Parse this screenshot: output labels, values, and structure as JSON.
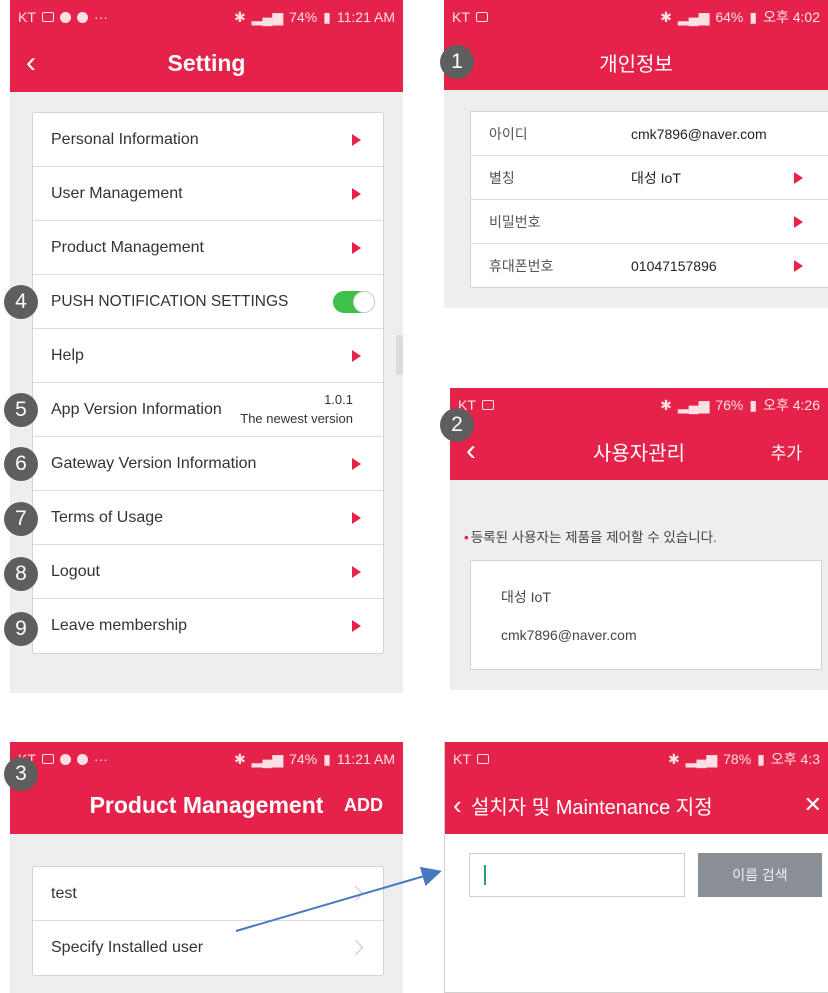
{
  "colors": {
    "accent": "#e5234a",
    "toggle_on": "#3ec14a",
    "badge": "#5e5e5e",
    "annotation": "#4a78c0"
  },
  "settings": {
    "status": {
      "left": "KT",
      "left_extra": "···",
      "right": "74%",
      "time": "11:21 AM"
    },
    "title": "Setting",
    "items": [
      {
        "label": "Personal Information"
      },
      {
        "label": "User Management"
      },
      {
        "label": "Product Management"
      },
      {
        "label": "PUSH NOTIFICATION SETTINGS",
        "toggle_on": true
      },
      {
        "label": "Help"
      },
      {
        "label": "App Version Information",
        "version": "1.0.1",
        "version_note": "The newest version"
      },
      {
        "label": "Gateway Version Information"
      },
      {
        "label": "Terms of Usage"
      },
      {
        "label": "Logout"
      },
      {
        "label": "Leave membership"
      }
    ]
  },
  "personal_info": {
    "status": {
      "left": "KT",
      "right": "64%",
      "time": "오후 4:02"
    },
    "title": "개인정보",
    "rows": [
      {
        "key": "아이디",
        "value": "cmk7896@naver.com"
      },
      {
        "key": "별칭",
        "value": "대성 IoT"
      },
      {
        "key": "비밀번호",
        "value": ""
      },
      {
        "key": "휴대폰번호",
        "value": "01047157896"
      }
    ]
  },
  "user_mgmt": {
    "status": {
      "left": "KT",
      "right": "76%",
      "time": "오후 4:26"
    },
    "title": "사용자관리",
    "action": "추가",
    "notice": "등록된 사용자는 제품을 제어할 수 있습니다.",
    "user": {
      "name": "대성 IoT",
      "email": "cmk7896@naver.com"
    }
  },
  "product_mgmt": {
    "status": {
      "left": "KT",
      "left_extra": "···",
      "right": "74%",
      "time": "11:21 AM"
    },
    "title": "Product Management",
    "action": "ADD",
    "items": [
      {
        "label": "test"
      },
      {
        "label": "Specify Installed user"
      }
    ]
  },
  "installer": {
    "status": {
      "left": "KT",
      "right": "78%",
      "time": "오후 4:3"
    },
    "title": "설치자 및 Maintenance 지정",
    "close": "✕",
    "search_value": "",
    "search_button": "이름 검색"
  },
  "badges": [
    "1",
    "2",
    "3",
    "4",
    "5",
    "6",
    "7",
    "8",
    "9"
  ]
}
